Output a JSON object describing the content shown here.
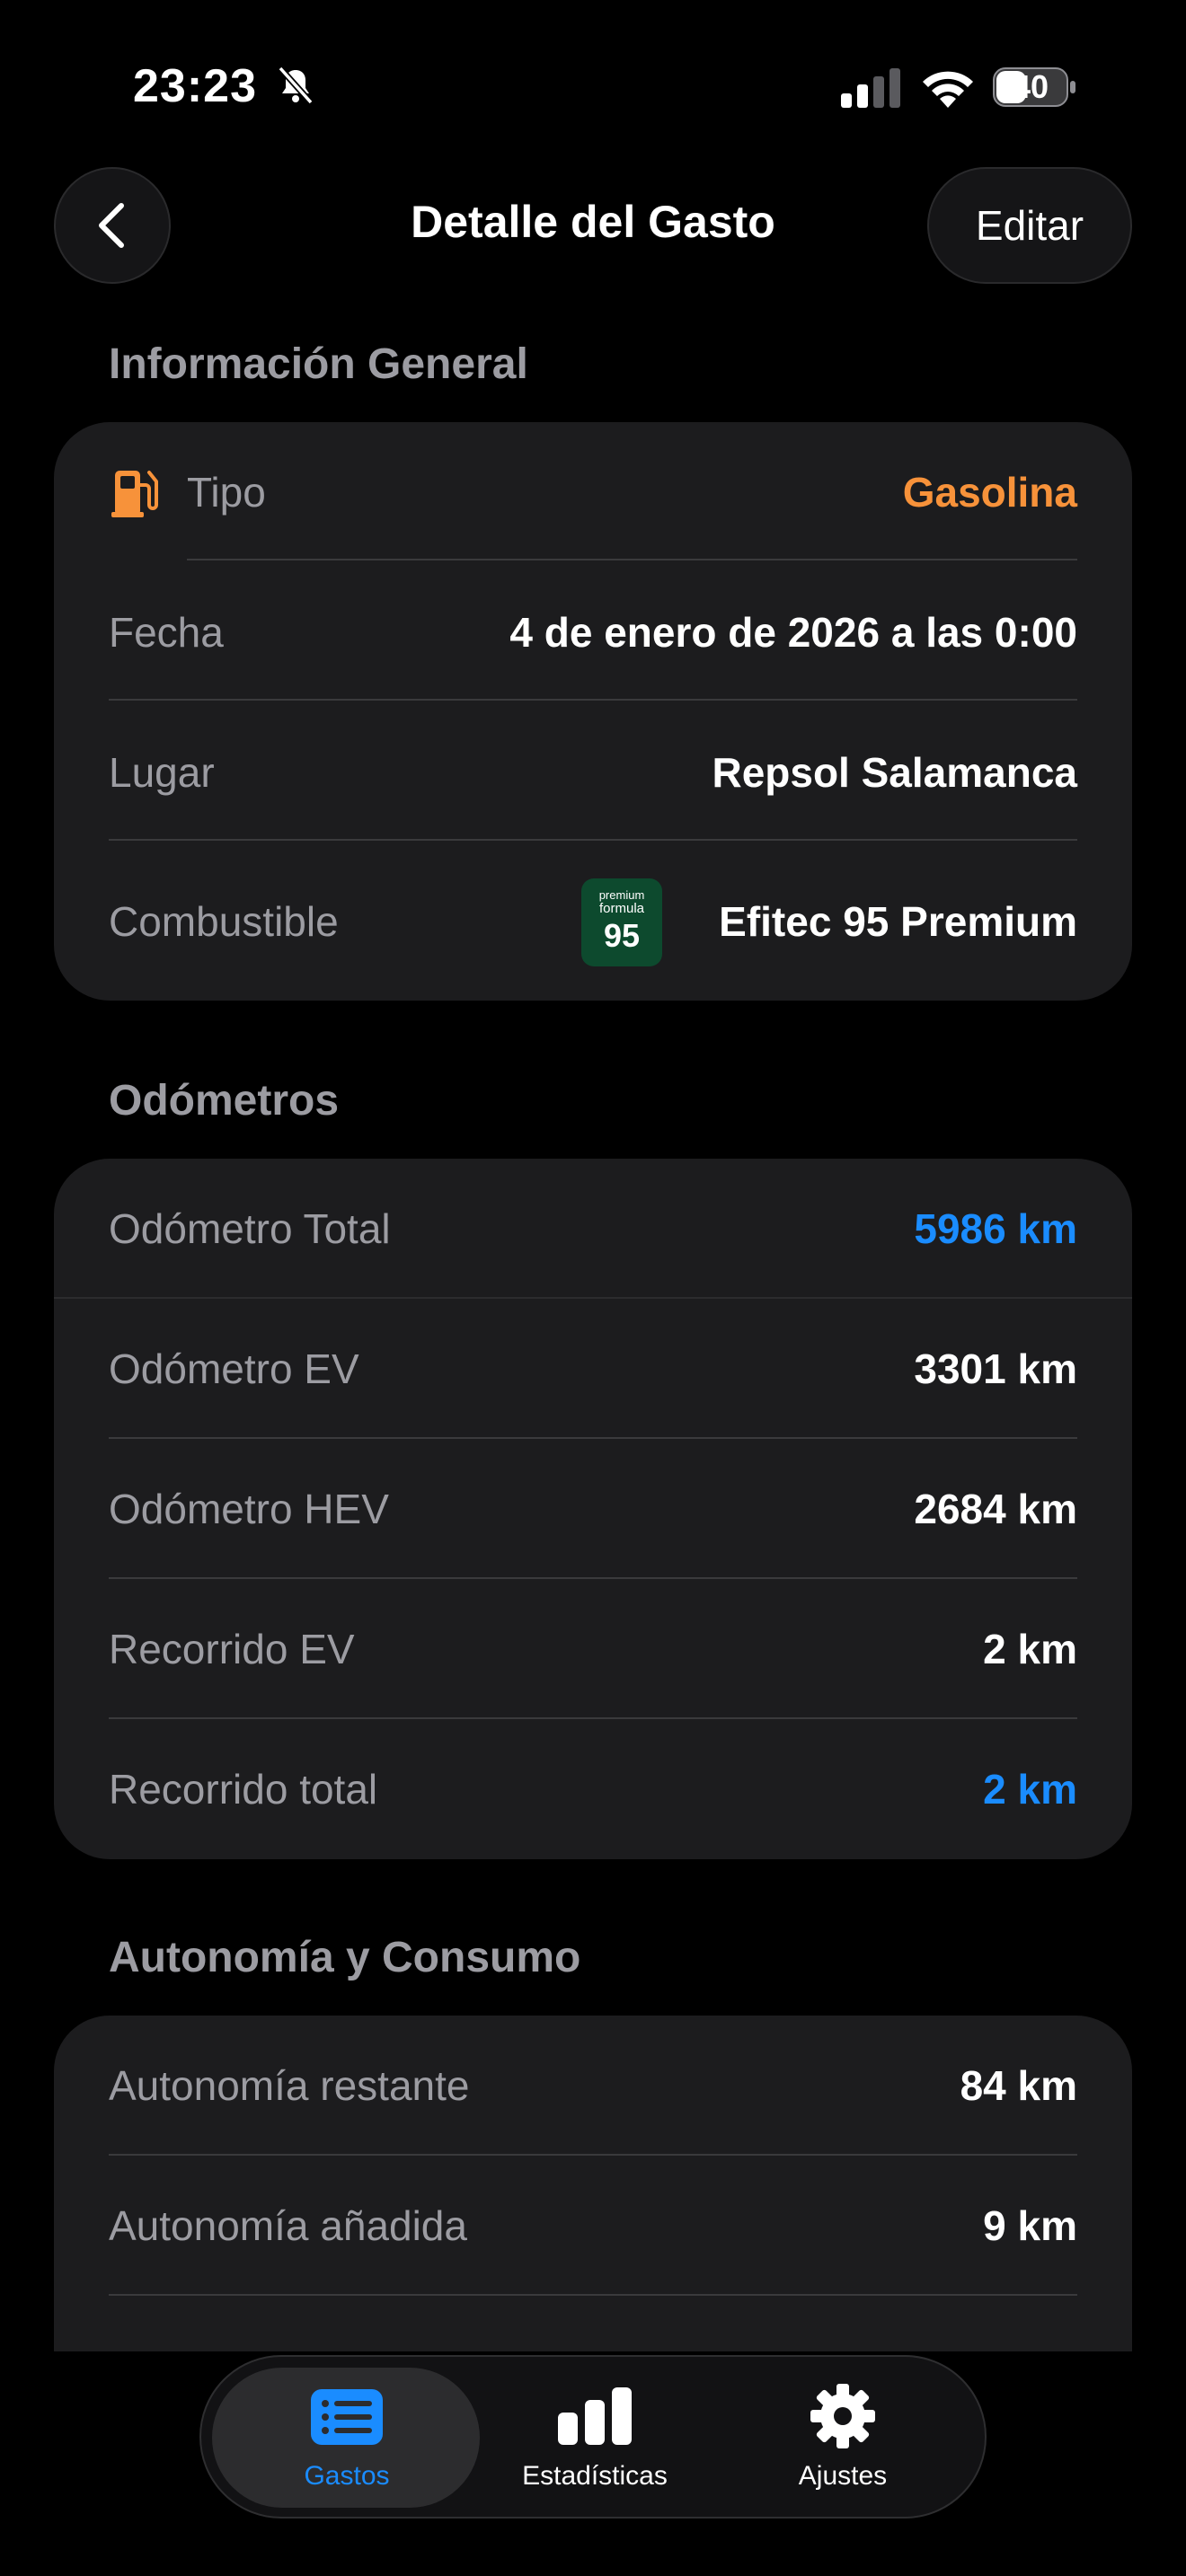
{
  "status_bar": {
    "time": "23:23",
    "battery": "40"
  },
  "nav": {
    "title": "Detalle del Gasto",
    "edit_label": "Editar"
  },
  "sections": {
    "general_title": "Información General",
    "odometers_title": "Odómetros",
    "autonomy_title": "Autonomía y Consumo"
  },
  "general": {
    "type_label": "Tipo",
    "type_value": "Gasolina",
    "date_label": "Fecha",
    "date_value": "4 de enero de 2026 a las 0:00",
    "place_label": "Lugar",
    "place_value": "Repsol Salamanca",
    "fuel_label": "Combustible",
    "fuel_value": "Efitec 95 Premium",
    "fuel_badge": {
      "line1": "premium",
      "line2": "formula",
      "number": "95"
    }
  },
  "odometers": [
    {
      "label": "Odómetro Total",
      "value": "5986 km"
    },
    {
      "label": "Odómetro EV",
      "value": "3301 km"
    },
    {
      "label": "Odómetro HEV",
      "value": "2684 km"
    },
    {
      "label": "Recorrido EV",
      "value": "2 km"
    },
    {
      "label": "Recorrido total",
      "value": "2 km"
    }
  ],
  "autonomy": [
    {
      "label": "Autonomía restante",
      "value": "84 km"
    },
    {
      "label": "Autonomía añadida",
      "value": "9 km"
    }
  ],
  "tabs": [
    {
      "label": "Gastos",
      "icon": "list-icon",
      "active": true
    },
    {
      "label": "Estadísticas",
      "icon": "bar-chart-icon",
      "active": false
    },
    {
      "label": "Ajustes",
      "icon": "gear-icon",
      "active": false
    }
  ],
  "colors": {
    "accent_blue": "#1a8cff",
    "accent_orange": "#f7923a",
    "card_bg": "#1c1c1e"
  }
}
